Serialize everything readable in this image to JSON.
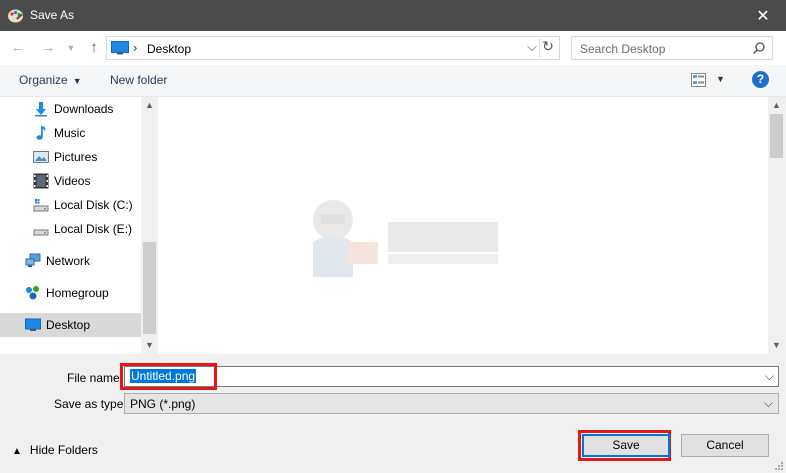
{
  "window": {
    "title": "Save As",
    "close_glyph": "✕"
  },
  "nav": {
    "back_glyph": "←",
    "forward_glyph": "→",
    "recent_glyph": "▼",
    "up_glyph": "↑",
    "address": {
      "chevron": "›",
      "crumb": "Desktop",
      "dropdown_glyph": "⌵",
      "refresh_glyph": "↻"
    },
    "search_placeholder": "Search Desktop"
  },
  "toolbar": {
    "organize": "Organize",
    "organize_caret": "▼",
    "new_folder": "New folder",
    "view_caret": "▼",
    "help": "?"
  },
  "sidebar": {
    "items": [
      {
        "label": "Downloads",
        "icon": "downloads-icon"
      },
      {
        "label": "Music",
        "icon": "music-icon"
      },
      {
        "label": "Pictures",
        "icon": "pictures-icon"
      },
      {
        "label": "Videos",
        "icon": "videos-icon"
      },
      {
        "label": "Local Disk (C:)",
        "icon": "drive-icon"
      },
      {
        "label": "Local Disk (E:)",
        "icon": "drive-icon"
      },
      {
        "label": "Network",
        "icon": "network-icon"
      },
      {
        "label": "Homegroup",
        "icon": "homegroup-icon"
      },
      {
        "label": "Desktop",
        "icon": "desktop-icon",
        "selected": true
      }
    ],
    "scroll_up": "▲",
    "scroll_down": "▼"
  },
  "content": {
    "scroll_up": "▲",
    "scroll_down": "▼",
    "watermark_icon": "appuals-logo-icon"
  },
  "form": {
    "file_name_label": "File name:",
    "file_name_value": "Untitled.png",
    "file_name_dropdown": "⌵",
    "save_as_type_label": "Save as type:",
    "save_as_type_value": "PNG (*.png)",
    "save_as_type_dropdown": "⌵"
  },
  "footer": {
    "hide_folders_glyph": "▲",
    "hide_folders": "Hide Folders",
    "save": "Save",
    "cancel": "Cancel"
  },
  "colors": {
    "accent": "#0078d7",
    "highlight_box": "#e31919",
    "titlebar": "#4b4b4b",
    "link_text": "#1e395b"
  }
}
